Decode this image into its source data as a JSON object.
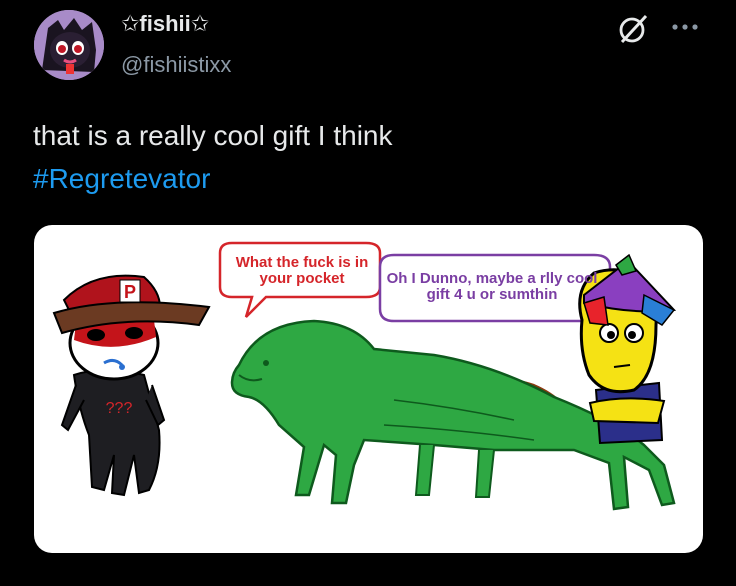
{
  "post": {
    "display_name": "✩fishii✩",
    "handle": "@fishiistixx",
    "text": "that is a really cool gift I think",
    "hashtag": "#Regretevator"
  },
  "icons": {
    "avatar": "avatar",
    "grok": "grok-icon",
    "more": "more-icon"
  },
  "image": {
    "bubble_1": "What the fuck is in your pocket",
    "bubble_2": "Oh I Dunno, maybe a rlly cool gift 4 u or sumthin",
    "shirt_text": "???",
    "hat_letter": "P"
  },
  "colors": {
    "background": "#000000",
    "text": "#e7e9ea",
    "secondary_text": "#8b98a5",
    "hashtag": "#1d9bf0",
    "bubble_1_text": "#d5252a",
    "bubble_2_text": "#7a3ea3",
    "creature": "#2ea843"
  }
}
